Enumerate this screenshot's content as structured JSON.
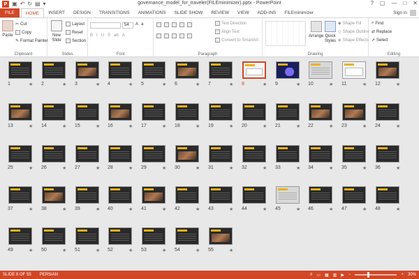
{
  "app": {
    "title": "governance_model_for_traveler(FILEminimizer).pptx - PowerPoint",
    "logo_letter": "P"
  },
  "window_controls": [
    "?",
    "▢",
    "—",
    "□",
    "✕"
  ],
  "tabs": [
    {
      "label": "FILE"
    },
    {
      "label": "HOME"
    },
    {
      "label": "INSERT"
    },
    {
      "label": "DESIGN"
    },
    {
      "label": "TRANSITIONS"
    },
    {
      "label": "ANIMATIONS"
    },
    {
      "label": "SLIDE SHOW"
    },
    {
      "label": "REVIEW"
    },
    {
      "label": "VIEW"
    },
    {
      "label": "ADD-INS"
    },
    {
      "label": "FILEminimizer"
    }
  ],
  "signin": "Sign in",
  "ribbon": {
    "clipboard": {
      "label": "Clipboard",
      "paste": "Paste",
      "cut": "Cut",
      "copy": "Copy",
      "format_painter": "Format Painter"
    },
    "slides": {
      "label": "Slides",
      "new_slide": "New Slide",
      "layout": "Layout",
      "reset": "Reset",
      "section": "Section"
    },
    "font": {
      "label": "Font",
      "size": "54"
    },
    "paragraph": {
      "label": "Paragraph",
      "text_direction": "Text Direction",
      "align_text": "Align Text",
      "convert_smartart": "Convert to SmartArt"
    },
    "drawing": {
      "label": "Drawing",
      "arrange": "Arrange",
      "quick_styles": "Quick Styles",
      "shape_fill": "Shape Fill",
      "shape_outline": "Shape Outline",
      "shape_effects": "Shape Effects"
    },
    "editing": {
      "label": "Editing",
      "find": "Find",
      "replace": "Replace",
      "select": "Select"
    }
  },
  "slides": [
    {
      "n": "1",
      "style": "dark"
    },
    {
      "n": "2",
      "style": "dark"
    },
    {
      "n": "3",
      "style": "photo"
    },
    {
      "n": "4",
      "style": "dark"
    },
    {
      "n": "5",
      "style": "dark"
    },
    {
      "n": "6",
      "style": "photo"
    },
    {
      "n": "7",
      "style": "dark"
    },
    {
      "n": "8",
      "style": "white",
      "selected": true
    },
    {
      "n": "9",
      "style": "blue"
    },
    {
      "n": "10",
      "style": "light"
    },
    {
      "n": "11",
      "style": "white"
    },
    {
      "n": "12",
      "style": "photo"
    },
    {
      "n": "13",
      "style": "photo"
    },
    {
      "n": "14",
      "style": "dark"
    },
    {
      "n": "15",
      "style": "dark"
    },
    {
      "n": "16",
      "style": "photo"
    },
    {
      "n": "17",
      "style": "dark"
    },
    {
      "n": "18",
      "style": "dark"
    },
    {
      "n": "19",
      "style": "dark"
    },
    {
      "n": "20",
      "style": "dark"
    },
    {
      "n": "21",
      "style": "dark"
    },
    {
      "n": "22",
      "style": "photo"
    },
    {
      "n": "23",
      "style": "photo"
    },
    {
      "n": "24",
      "style": "dark"
    },
    {
      "n": "25",
      "style": "dark"
    },
    {
      "n": "26",
      "style": "dark"
    },
    {
      "n": "27",
      "style": "dark"
    },
    {
      "n": "28",
      "style": "dark"
    },
    {
      "n": "29",
      "style": "dark"
    },
    {
      "n": "30",
      "style": "photo"
    },
    {
      "n": "31",
      "style": "dark"
    },
    {
      "n": "32",
      "style": "dark"
    },
    {
      "n": "33",
      "style": "dark"
    },
    {
      "n": "34",
      "style": "dark"
    },
    {
      "n": "35",
      "style": "dark"
    },
    {
      "n": "36",
      "style": "dark"
    },
    {
      "n": "37",
      "style": "dark"
    },
    {
      "n": "38",
      "style": "photo"
    },
    {
      "n": "39",
      "style": "dark"
    },
    {
      "n": "40",
      "style": "dark"
    },
    {
      "n": "41",
      "style": "photo"
    },
    {
      "n": "42",
      "style": "dark"
    },
    {
      "n": "43",
      "style": "dark"
    },
    {
      "n": "44",
      "style": "dark"
    },
    {
      "n": "45",
      "style": "light"
    },
    {
      "n": "46",
      "style": "dark"
    },
    {
      "n": "47",
      "style": "dark"
    },
    {
      "n": "48",
      "style": "dark"
    },
    {
      "n": "49",
      "style": "dark"
    },
    {
      "n": "50",
      "style": "dark"
    },
    {
      "n": "51",
      "style": "dark"
    },
    {
      "n": "52",
      "style": "dark"
    },
    {
      "n": "53",
      "style": "dark"
    },
    {
      "n": "54",
      "style": "dark"
    },
    {
      "n": "55",
      "style": "photo"
    }
  ],
  "star": "★",
  "status": {
    "slide_info": "SLIDE 8 OF 55",
    "language": "PERSIAN",
    "zoom": "30%",
    "zoom_fraction": 0.3
  }
}
